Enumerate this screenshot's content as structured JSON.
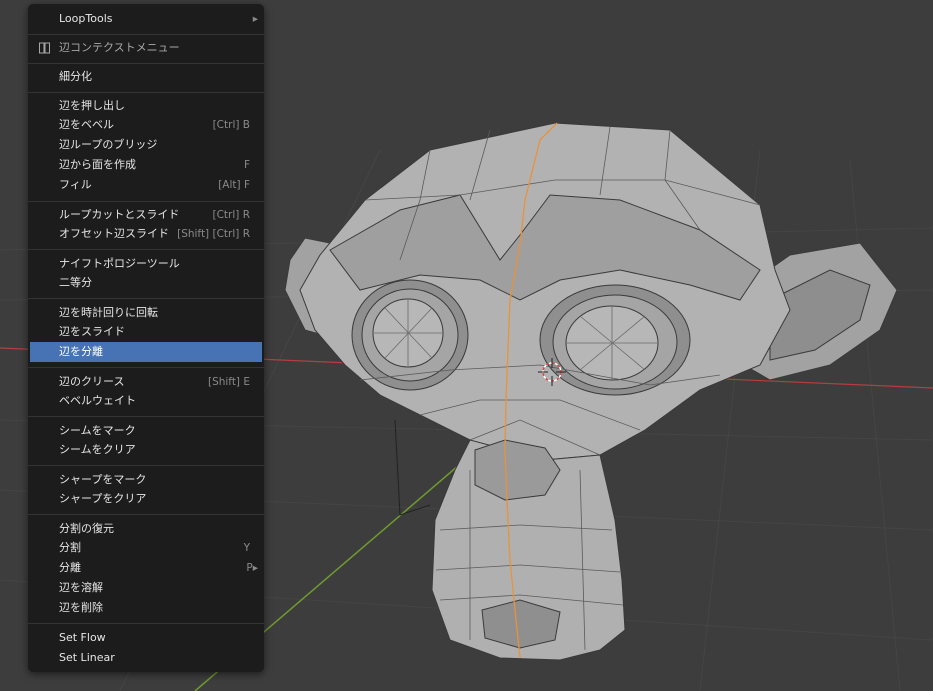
{
  "menu": {
    "loop_tools": {
      "label": "LoopTools",
      "shortcut": "▸"
    },
    "header": {
      "label": "辺コンテクストメニュー"
    },
    "subdivide": {
      "label": "細分化"
    },
    "extrude_edges": {
      "label": "辺を押し出し"
    },
    "bevel_edges": {
      "label": "辺をベベル",
      "shortcut": "[Ctrl] B"
    },
    "bridge_edge_loops": {
      "label": "辺ループのブリッジ"
    },
    "new_face_from_edges": {
      "label": "辺から面を作成",
      "shortcut": "F"
    },
    "fill": {
      "label": "フィル",
      "shortcut": "[Alt] F"
    },
    "loop_cut_slide": {
      "label": "ループカットとスライド",
      "shortcut": "[Ctrl] R"
    },
    "offset_edge_slide": {
      "label": "オフセット辺スライド",
      "shortcut": "[Shift] [Ctrl] R"
    },
    "knife_topology": {
      "label": "ナイフトポロジーツール"
    },
    "bisect": {
      "label": "二等分"
    },
    "rotate_edge_cw": {
      "label": "辺を時計回りに回転"
    },
    "edge_slide": {
      "label": "辺をスライド"
    },
    "edge_split": {
      "label": "辺を分離"
    },
    "edge_crease": {
      "label": "辺のクリース",
      "shortcut": "[Shift] E"
    },
    "bevel_weight": {
      "label": "ベベルウェイト"
    },
    "mark_seam": {
      "label": "シームをマーク"
    },
    "clear_seam": {
      "label": "シームをクリア"
    },
    "mark_sharp": {
      "label": "シャープをマーク"
    },
    "clear_sharp": {
      "label": "シャープをクリア"
    },
    "un_subdivide": {
      "label": "分割の復元"
    },
    "split": {
      "label": "分割",
      "shortcut": "Y"
    },
    "separate": {
      "label": "分離",
      "shortcut": "P▸"
    },
    "dissolve_edges": {
      "label": "辺を溶解"
    },
    "delete_edges": {
      "label": "辺を削除"
    },
    "set_flow": {
      "label": "Set Flow"
    },
    "set_linear": {
      "label": "Set Linear"
    }
  },
  "colors": {
    "menu_bg": "#1c1c1c",
    "highlight": "#4772b3",
    "viewport_bg": "#3d3d3d",
    "x_axis": "#b33f3f",
    "y_axis": "#6f9a2f",
    "selected_edge": "#e8923a",
    "mesh_face": "#a8a8a8"
  }
}
